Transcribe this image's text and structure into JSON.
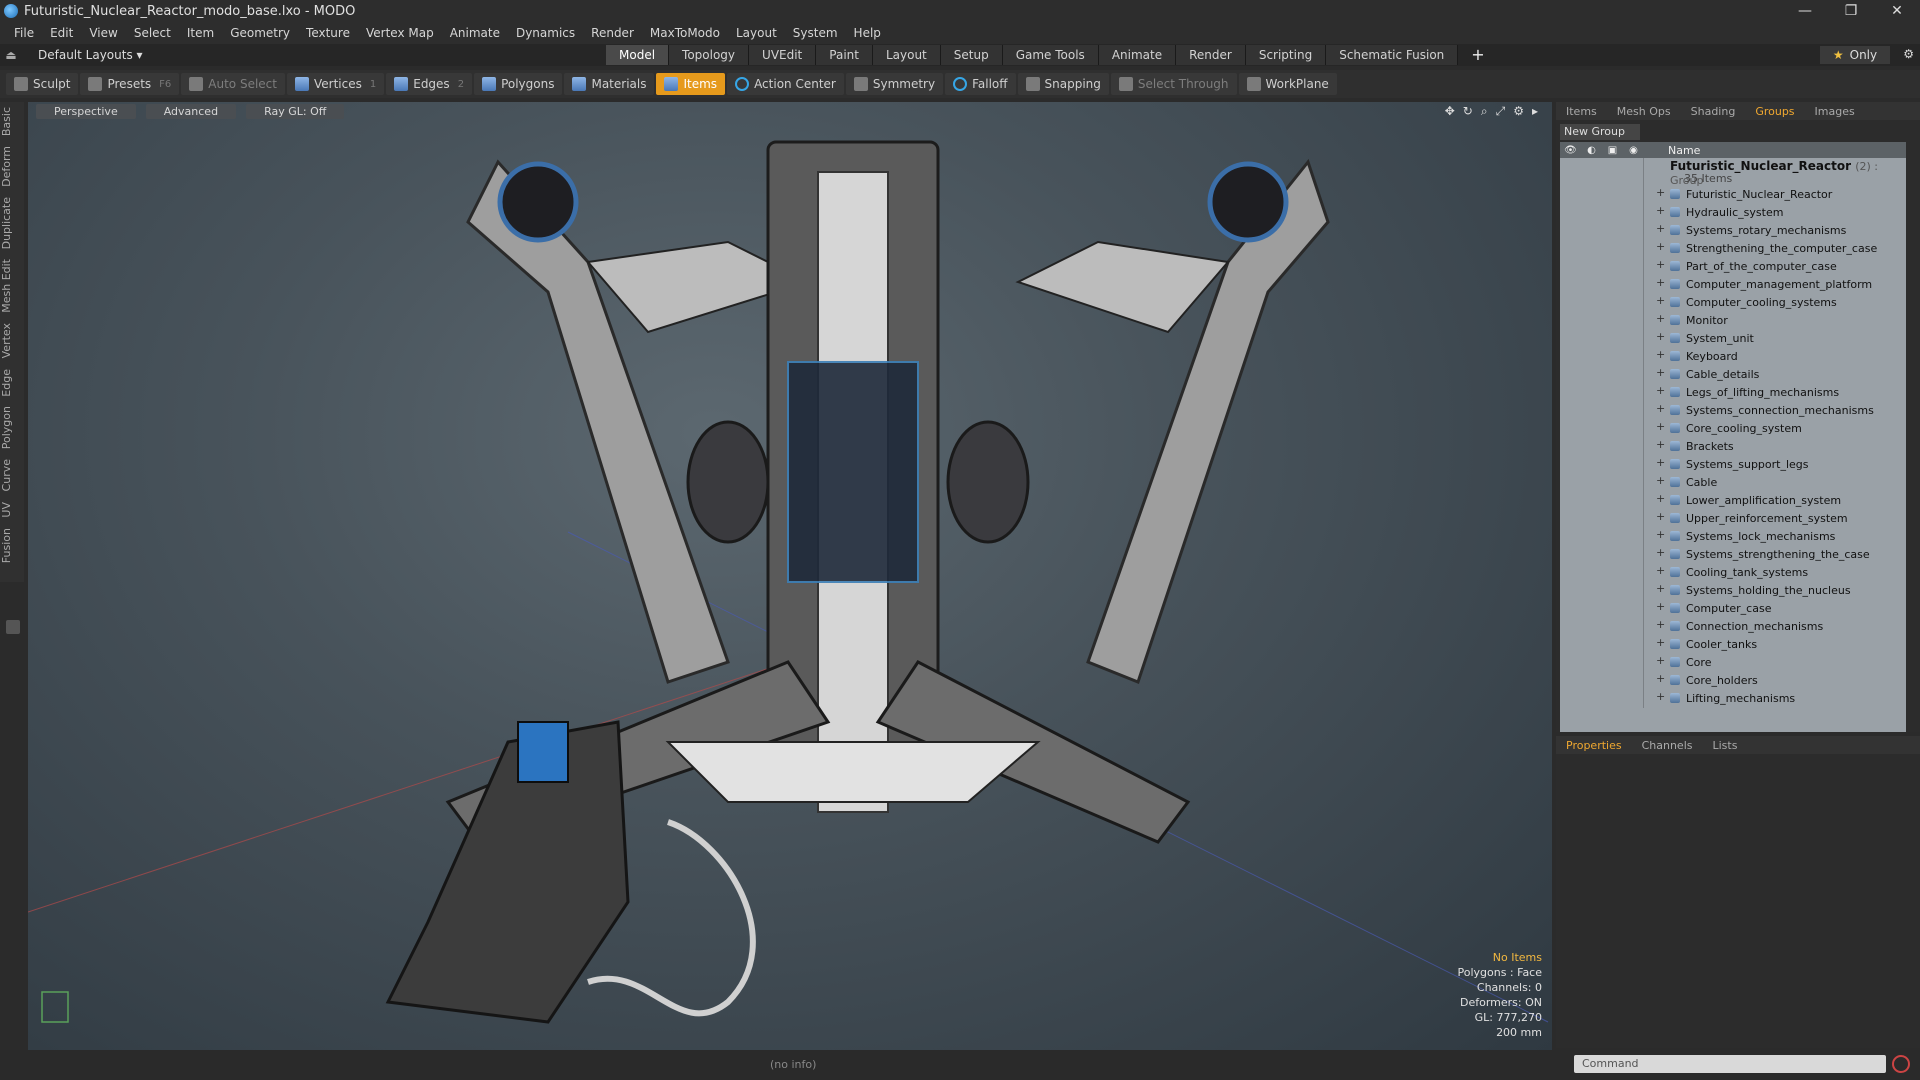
{
  "window": {
    "title": "Futuristic_Nuclear_Reactor_modo_base.lxo - MODO"
  },
  "menu": [
    "File",
    "Edit",
    "View",
    "Select",
    "Item",
    "Geometry",
    "Texture",
    "Vertex Map",
    "Animate",
    "Dynamics",
    "Render",
    "MaxToModo",
    "Layout",
    "System",
    "Help"
  ],
  "layout": {
    "name": "Default Layouts ▾"
  },
  "mode_tabs": [
    "Model",
    "Topology",
    "UVEdit",
    "Paint",
    "Layout",
    "Setup",
    "Game Tools",
    "Animate",
    "Render",
    "Scripting",
    "Schematic Fusion"
  ],
  "only_label": "Only",
  "toolbar": {
    "sculpt": "Sculpt",
    "presets": "Presets",
    "presets_key": "F6",
    "auto_select": "Auto Select",
    "vertices": "Vertices",
    "vertices_key": "1",
    "edges": "Edges",
    "edges_key": "2",
    "polygons": "Polygons",
    "materials": "Materials",
    "items": "Items",
    "action_center": "Action Center",
    "symmetry": "Symmetry",
    "falloff": "Falloff",
    "snapping": "Snapping",
    "select_through": "Select Through",
    "workplane": "WorkPlane"
  },
  "side_tabs": [
    "Basic",
    "Deform",
    "Duplicate",
    "Mesh Edit",
    "Vertex",
    "Edge",
    "Polygon",
    "Curve",
    "UV",
    "Fusion"
  ],
  "viewport": {
    "perspective": "Perspective",
    "advanced": "Advanced",
    "raygl": "Ray GL: Off",
    "info": {
      "items": "No Items",
      "polygons": "Polygons : Face",
      "channels": "Channels: 0",
      "deformers": "Deformers: ON",
      "gl": "GL: 777,270",
      "scale": "200 mm"
    }
  },
  "right_tabs": [
    "Items",
    "Mesh Ops",
    "Shading",
    "Groups",
    "Images"
  ],
  "new_group": "New Group",
  "list": {
    "name_header": "Name",
    "group_name": "Futuristic_Nuclear_Reactor",
    "group_tag": "(2) : Group",
    "group_count": "35 Items",
    "items": [
      "Futuristic_Nuclear_Reactor",
      "Hydraulic_system",
      "Systems_rotary_mechanisms",
      "Strengthening_the_computer_case",
      "Part_of_the_computer_case",
      "Computer_management_platform",
      "Computer_cooling_systems",
      "Monitor",
      "System_unit",
      "Keyboard",
      "Cable_details",
      "Legs_of_lifting_mechanisms",
      "Systems_connection_mechanisms",
      "Core_cooling_system",
      "Brackets",
      "Systems_support_legs",
      "Cable",
      "Lower_amplification_system",
      "Upper_reinforcement_system",
      "Systems_lock_mechanisms",
      "Systems_strengthening_the_case",
      "Cooling_tank_systems",
      "Systems_holding_the_nucleus",
      "Computer_case",
      "Connection_mechanisms",
      "Cooler_tanks",
      "Core",
      "Core_holders",
      "Lifting_mechanisms"
    ]
  },
  "prop_tabs": [
    "Properties",
    "Channels",
    "Lists"
  ],
  "status": {
    "info": "(no info)",
    "command_placeholder": "Command"
  }
}
